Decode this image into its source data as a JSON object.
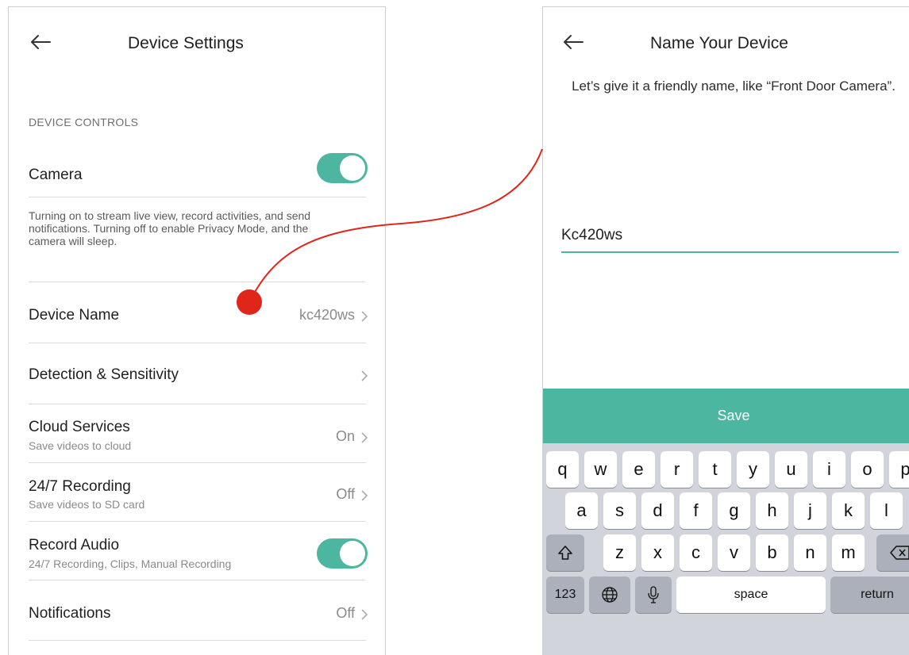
{
  "left": {
    "title": "Device Settings",
    "section_header": "DEVICE CONTROLS",
    "camera": {
      "label": "Camera",
      "on": true
    },
    "camera_description": "Turning on to stream live view, record activities, and send notifications. Turning off to enable Privacy Mode, and the camera will sleep.",
    "device_name": {
      "label": "Device Name",
      "value": "kc420ws"
    },
    "detection": {
      "label": "Detection & Sensitivity"
    },
    "cloud": {
      "label": "Cloud Services",
      "sub": "Save videos to cloud",
      "value": "On"
    },
    "recording": {
      "label": "24/7 Recording",
      "sub": "Save videos to SD card",
      "value": "Off"
    },
    "record_audio": {
      "label": "Record Audio",
      "sub": "24/7 Recording, Clips, Manual Recording",
      "on": true
    },
    "notifications": {
      "label": "Notifications",
      "value": "Off"
    }
  },
  "right": {
    "title": "Name Your Device",
    "hint": "Let’s give it a friendly name, like “Front Door Camera”.",
    "input_value": "Kc420ws",
    "save_label": "Save"
  },
  "keyboard": {
    "row1": [
      "q",
      "w",
      "e",
      "r",
      "t",
      "y",
      "u",
      "i",
      "o",
      "p"
    ],
    "row2": [
      "a",
      "s",
      "d",
      "f",
      "g",
      "h",
      "j",
      "k",
      "l"
    ],
    "row3": [
      "z",
      "x",
      "c",
      "v",
      "b",
      "n",
      "m"
    ],
    "numbers_label": "123",
    "space_label": "space",
    "return_label": "return"
  },
  "colors": {
    "accent": "#4db6a0",
    "connector": "#e0251b"
  }
}
